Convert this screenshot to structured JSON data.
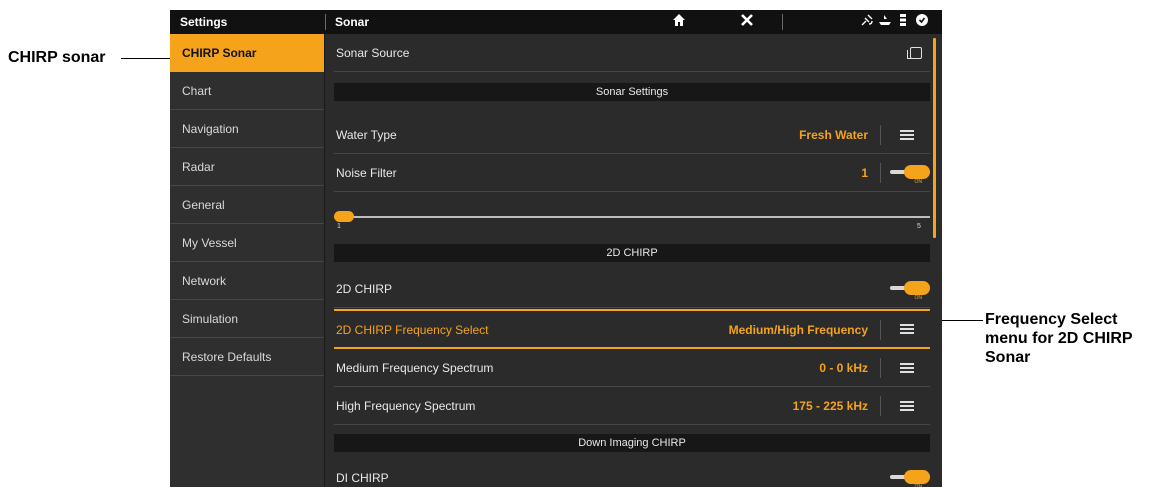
{
  "topbar": {
    "settings_title": "Settings",
    "section_title": "Sonar",
    "icons": [
      "home-icon",
      "close-icon",
      "satellite-icon",
      "boat-icon",
      "temperature-icon",
      "settings-icon"
    ]
  },
  "sidebar": {
    "items": [
      {
        "label": "CHIRP Sonar",
        "active": true
      },
      {
        "label": "Chart"
      },
      {
        "label": "Navigation"
      },
      {
        "label": "Radar"
      },
      {
        "label": "General"
      },
      {
        "label": "My Vessel"
      },
      {
        "label": "Network"
      },
      {
        "label": "Simulation"
      },
      {
        "label": "Restore Defaults"
      }
    ]
  },
  "main": {
    "sonar_source_label": "Sonar Source",
    "sonar_settings_header": "Sonar Settings",
    "water_type": {
      "label": "Water Type",
      "value": "Fresh Water"
    },
    "noise_filter": {
      "label": "Noise Filter",
      "value": "1"
    },
    "slider": {
      "min_label": "1",
      "max_label": "5",
      "value": 1
    },
    "chirp2d_header": "2D CHIRP",
    "chirp2d_toggle_label": "2D CHIRP",
    "freq_select": {
      "label": "2D CHIRP Frequency Select",
      "value": "Medium/High Frequency"
    },
    "medium_spectrum": {
      "label": "Medium Frequency Spectrum",
      "value": "0 - 0 kHz"
    },
    "high_spectrum": {
      "label": "High Frequency Spectrum",
      "value": "175 - 225 kHz"
    },
    "di_header": "Down Imaging CHIRP",
    "di_chirp_label": "DI CHIRP",
    "toggle_on_text": "ON"
  },
  "callouts": {
    "left": "CHIRP sonar",
    "right_lines": [
      "Frequency Select",
      "menu for 2D CHIRP",
      "Sonar"
    ]
  },
  "colors": {
    "accent": "#f5a31a",
    "background": "#2b2b2b",
    "topbar": "#111111"
  }
}
